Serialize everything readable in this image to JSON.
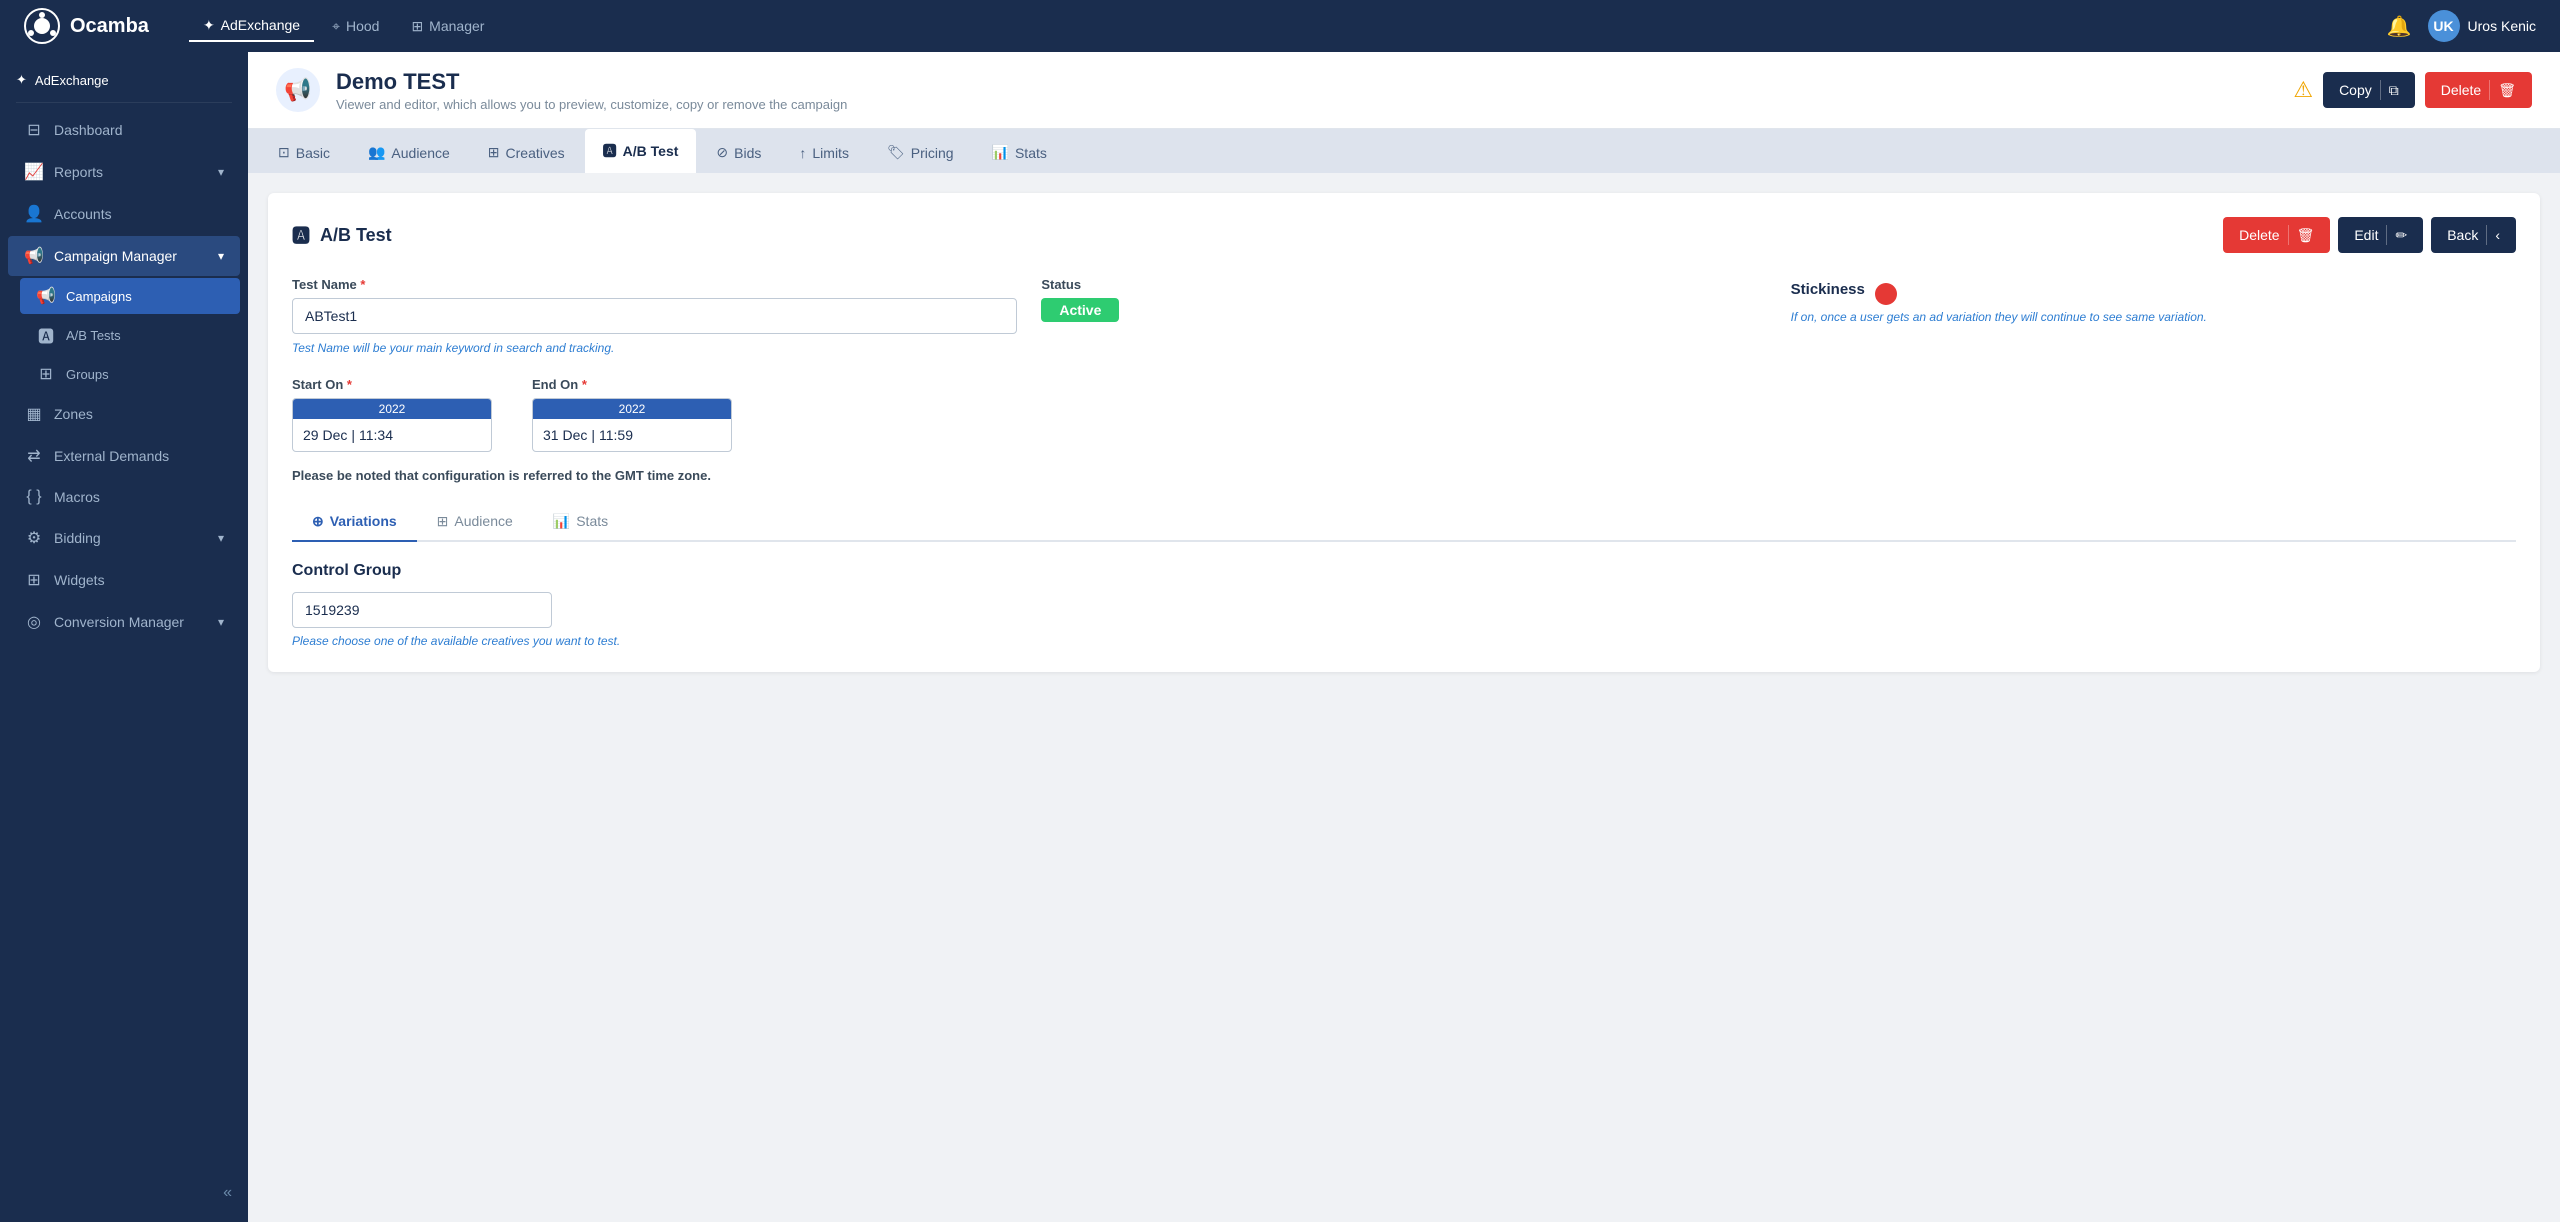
{
  "app": {
    "logo_text": "Ocamba"
  },
  "top_nav": {
    "links": [
      {
        "label": "AdExchange",
        "active": true
      },
      {
        "label": "Hood",
        "active": false
      },
      {
        "label": "Manager",
        "active": false
      }
    ],
    "user_name": "Uros Kenic"
  },
  "sidebar": {
    "section": "AdExchange",
    "items": [
      {
        "label": "Dashboard",
        "icon": "dashboard",
        "active": false
      },
      {
        "label": "Reports",
        "icon": "reports",
        "active": false,
        "has_chevron": true
      },
      {
        "label": "Accounts",
        "icon": "accounts",
        "active": false
      },
      {
        "label": "Campaign Manager",
        "icon": "campaign",
        "active": true,
        "has_chevron": true
      },
      {
        "label": "Campaigns",
        "icon": "campaigns",
        "sub": true,
        "active_sub": true
      },
      {
        "label": "A/B Tests",
        "icon": "ab",
        "sub": true,
        "active_sub": false
      },
      {
        "label": "Groups",
        "icon": "groups",
        "sub": true,
        "active_sub": false
      },
      {
        "label": "Zones",
        "icon": "zones",
        "active": false
      },
      {
        "label": "External Demands",
        "icon": "external",
        "active": false
      },
      {
        "label": "Macros",
        "icon": "macros",
        "active": false
      },
      {
        "label": "Bidding",
        "icon": "bidding",
        "active": false,
        "has_chevron": true
      },
      {
        "label": "Widgets",
        "icon": "widgets",
        "active": false
      },
      {
        "label": "Conversion Manager",
        "icon": "conversion",
        "active": false,
        "has_chevron": true
      }
    ],
    "collapse_label": "«"
  },
  "campaign_header": {
    "title": "Demo TEST",
    "subtitle": "Viewer and editor, which allows you to preview, customize, copy or remove the campaign",
    "copy_label": "Copy",
    "delete_label": "Delete"
  },
  "tabs": [
    {
      "label": "Basic",
      "active": false
    },
    {
      "label": "Audience",
      "active": false
    },
    {
      "label": "Creatives",
      "active": false
    },
    {
      "label": "A/B Test",
      "active": true
    },
    {
      "label": "Bids",
      "active": false
    },
    {
      "label": "Limits",
      "active": false
    },
    {
      "label": "Pricing",
      "active": false
    },
    {
      "label": "Stats",
      "active": false
    }
  ],
  "panel": {
    "title": "A/B Test",
    "delete_btn": "Delete",
    "edit_btn": "Edit",
    "back_btn": "Back",
    "test_name_label": "Test Name",
    "test_name_required": "*",
    "test_name_value": "ABTest1",
    "test_name_hint": "Test Name will be your main keyword in search and tracking.",
    "status_label": "Status",
    "status_value": "Active",
    "start_label": "Start On",
    "start_required": "*",
    "start_year": "2022",
    "start_date": "29 Dec",
    "start_time": "11:34",
    "end_label": "End On",
    "end_required": "*",
    "end_year": "2022",
    "end_date": "31 Dec",
    "end_time": "11:59",
    "stickiness_label": "Stickiness",
    "stickiness_hint": "If on, once a user gets an ad variation they will continue to see same variation.",
    "timezone_note": "Please be noted that configuration is referred to the GMT time zone.",
    "sub_tabs": [
      {
        "label": "Variations",
        "active": true
      },
      {
        "label": "Audience",
        "active": false
      },
      {
        "label": "Stats",
        "active": false
      }
    ],
    "control_group_label": "Control Group",
    "control_group_value": "1519239",
    "control_group_hint": "Please choose one of the available creatives you want to test."
  }
}
